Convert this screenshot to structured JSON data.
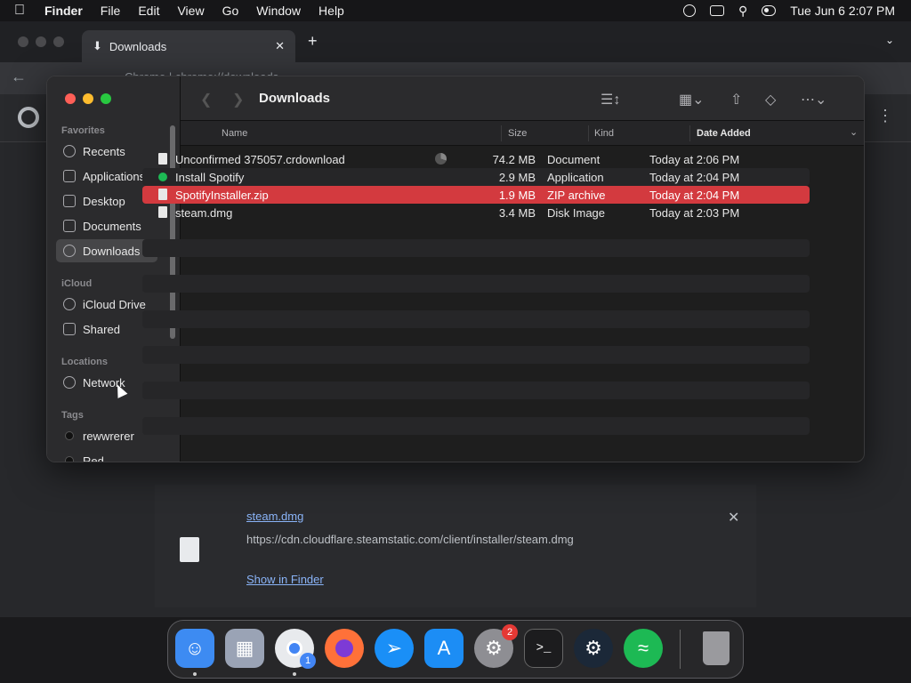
{
  "menubar": {
    "app_name": "Finder",
    "menus": [
      "File",
      "Edit",
      "View",
      "Go",
      "Window",
      "Help"
    ],
    "clock": "Tue Jun 6  2:07 PM"
  },
  "chrome": {
    "tab_title": "Downloads",
    "address": "Chrome  |  chrome://downloads",
    "download_card": {
      "file_name": "steam.dmg",
      "url": "https://cdn.cloudflare.steamstatic.com/client/installer/steam.dmg",
      "show_in_finder": "Show in Finder"
    }
  },
  "finder": {
    "title": "Downloads",
    "sidebar": {
      "favorites_header": "Favorites",
      "favorites": [
        "Recents",
        "Applications",
        "Desktop",
        "Documents",
        "Downloads"
      ],
      "icloud_header": "iCloud",
      "icloud": [
        "iCloud Drive",
        "Shared"
      ],
      "locations_header": "Locations",
      "locations": [
        "Network"
      ],
      "tags_header": "Tags",
      "tags": [
        "rewwrerer",
        "Red"
      ]
    },
    "columns": {
      "name": "Name",
      "size": "Size",
      "kind": "Kind",
      "date": "Date Added"
    },
    "files": [
      {
        "name": "Unconfirmed 375057.crdownload",
        "size": "74.2 MB",
        "kind": "Document",
        "date": "Today at 2:06 PM"
      },
      {
        "name": "Install Spotify",
        "size": "2.9 MB",
        "kind": "Application",
        "date": "Today at 2:04 PM"
      },
      {
        "name": "SpotifyInstaller.zip",
        "size": "1.9 MB",
        "kind": "ZIP archive",
        "date": "Today at 2:04 PM"
      },
      {
        "name": "steam.dmg",
        "size": "3.4 MB",
        "kind": "Disk Image",
        "date": "Today at 2:03 PM"
      }
    ],
    "selected_file": "SpotifyInstaller.zip"
  },
  "dock": {
    "apps": [
      "Finder",
      "Launchpad",
      "Google Chrome",
      "Firefox",
      "Safari",
      "App Store",
      "System Settings",
      "Terminal",
      "Steam",
      "Spotify",
      "Trash"
    ],
    "badges": {
      "Google Chrome": "1",
      "System Settings": "2"
    }
  },
  "colors": {
    "selection": "#d33a3f",
    "link": "#8ab4f8"
  }
}
